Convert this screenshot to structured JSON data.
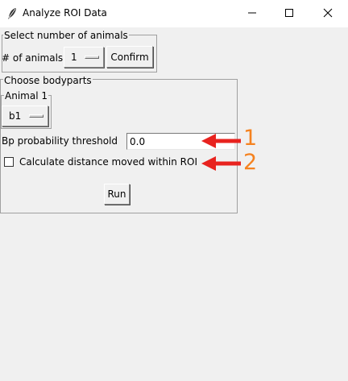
{
  "window": {
    "title": "Analyze ROI Data",
    "controls": [
      "minimize-icon",
      "maximize-icon",
      "close-icon"
    ]
  },
  "animals_group": {
    "label": "Select number of animals",
    "count_label": "# of animals",
    "count_value": "1",
    "confirm_label": "Confirm"
  },
  "bodyparts_group": {
    "label": "Choose bodyparts",
    "animal_group_label": "Animal 1",
    "bodypart_value": "b1",
    "threshold_label": "Bp probability threshold",
    "threshold_value": "0.0",
    "distance_checkbox_label": "Calculate distance moved within ROI",
    "distance_checked": false,
    "run_label": "Run"
  },
  "annotations": {
    "marker_1": "1",
    "marker_2": "2",
    "color": "#e8231f",
    "number_color": "#f5821f"
  }
}
